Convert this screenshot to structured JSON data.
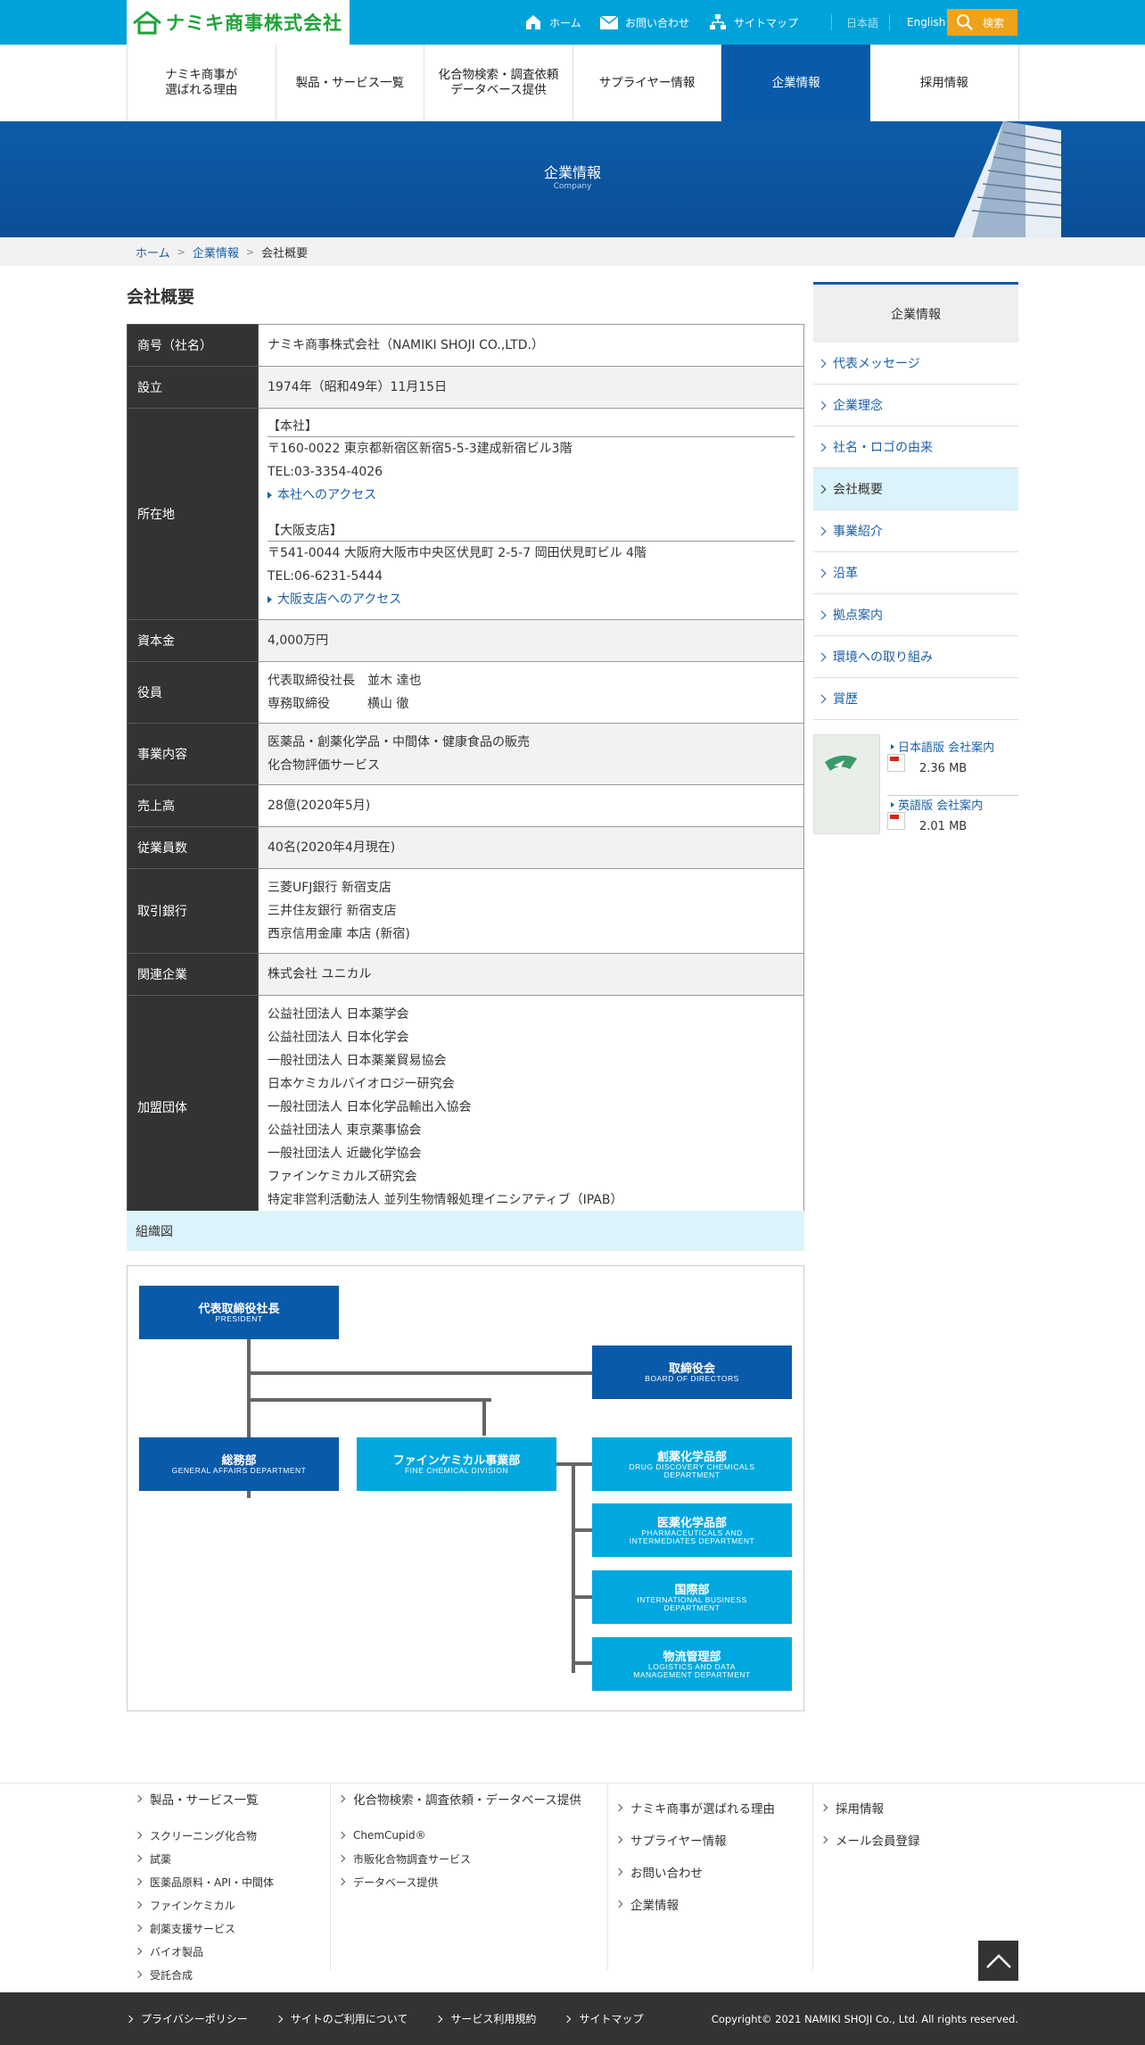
{
  "header": {
    "logo_text": "ナミキ商事株式会社",
    "links": {
      "home": "ホーム",
      "contact": "お問い合わせ",
      "sitemap": "サイトマップ",
      "lang_ja": "日本語",
      "lang_en": "English",
      "search": "検索"
    }
  },
  "gnav": [
    {
      "label": "ナミキ商事が\n選ばれる理由"
    },
    {
      "label": "製品・サービス一覧"
    },
    {
      "label": "化合物検索・調査依頼\nデータベース提供"
    },
    {
      "label": "サプライヤー情報"
    },
    {
      "label": "企業情報",
      "active": true
    },
    {
      "label": "採用情報"
    }
  ],
  "hero": {
    "title": "企業情報",
    "subtitle": "Company"
  },
  "breadcrumb": [
    "ホーム",
    "企業情報",
    "会社概要"
  ],
  "page_title": "会社概要",
  "table": {
    "trade_name": {
      "label": "商号（社名）",
      "value": "ナミキ商事株式会社（NAMIKI SHOJI CO.,LTD.）"
    },
    "founded": {
      "label": "設立",
      "value": "1974年（昭和49年）11月15日"
    },
    "location": {
      "label": "所在地",
      "hq": {
        "title": "【本社】",
        "address": "〒160-0022 東京都新宿区新宿5-5-3建成新宿ビル3階",
        "tel": "TEL:03-3354-4026",
        "access": "本社へのアクセス"
      },
      "osaka": {
        "title": "【大阪支店】",
        "address": "〒541-0044 大阪府大阪市中央区伏見町 2-5-7 岡田伏見町ビル 4階",
        "tel": "TEL:06-6231-5444",
        "access": "大阪支店へのアクセス"
      }
    },
    "capital": {
      "label": "資本金",
      "value": "4,000万円"
    },
    "officers": {
      "label": "役員",
      "lines": [
        "代表取締役社長　並木 達也",
        "専務取締役　　　横山 徹"
      ]
    },
    "business": {
      "label": "事業内容",
      "lines": [
        "医薬品・創薬化学品・中間体・健康食品の販売",
        "化合物評価サービス"
      ]
    },
    "sales": {
      "label": "売上高",
      "value": "28億(2020年5月)"
    },
    "employees": {
      "label": "従業員数",
      "value": "40名(2020年4月現在)"
    },
    "banks": {
      "label": "取引銀行",
      "lines": [
        "三菱UFJ銀行 新宿支店",
        "三井住友銀行 新宿支店",
        "西京信用金庫 本店 (新宿)"
      ]
    },
    "affiliates": {
      "label": "関連企業",
      "value": "株式会社 ユニカル"
    },
    "memberships": {
      "label": "加盟団体",
      "lines": [
        "公益社団法人 日本薬学会",
        "公益社団法人 日本化学会",
        "一般社団法人 日本薬業貿易協会",
        "日本ケミカルバイオロジー研究会",
        "一般社団法人 日本化学品輸出入協会",
        "公益社団法人 東京薬事協会",
        "一般社団法人 近畿化学協会",
        "ファインケミカルズ研究会",
        "特定非営利活動法人 並列生物情報処理イニシアティブ（IPAB）"
      ]
    }
  },
  "org": {
    "heading": "組織図",
    "president": {
      "ja": "代表取締役社長",
      "en": "PRESIDENT"
    },
    "board": {
      "ja": "取締役会",
      "en": "BOARD OF DIRECTORS"
    },
    "general": {
      "ja": "総務部",
      "en": "GENERAL AFFAIRS DEPARTMENT"
    },
    "fine": {
      "ja": "ファインケミカル事業部",
      "en": "FINE CHEMICAL DIVISION"
    },
    "drug": {
      "ja": "創薬化学品部",
      "en1": "DRUG DISCOVERY CHEMICALS",
      "en2": "DEPARTMENT"
    },
    "pharma": {
      "ja": "医薬化学品部",
      "en1": "PHARMACEUTICALS AND",
      "en2": "INTERMEDIATES DEPARTMENT"
    },
    "intl": {
      "ja": "国際部",
      "en1": "INTERNATIONAL BUSINESS",
      "en2": "DEPARTMENT"
    },
    "logistics": {
      "ja": "物流管理部",
      "en1": "LOGISTICS AND DATA",
      "en2": "MANAGEMENT DEPARTMENT"
    }
  },
  "sidebar": {
    "heading": "企業情報",
    "items": [
      "代表メッセージ",
      "企業理念",
      "社名・ロゴの由来",
      "会社概要",
      "事業紹介",
      "沿革",
      "拠点案内",
      "環境への取り組み",
      "賞歴"
    ],
    "current": "会社概要",
    "pdfs": [
      {
        "label": "日本語版 会社案内",
        "size": "2.36 MB"
      },
      {
        "label": "英語版 会社案内",
        "size": "2.01 MB"
      }
    ]
  },
  "footer": {
    "col1": {
      "head": "製品・サービス一覧",
      "items": [
        "スクリーニング化合物",
        "試薬",
        "医薬品原料・API・中間体",
        "ファインケミカル",
        "創薬支援サービス",
        "バイオ製品",
        "受託合成"
      ]
    },
    "col2": {
      "head": "化合物検索・調査依頼・データベース提供",
      "items": [
        "ChemCupid®",
        "市販化合物調査サービス",
        "データベース提供"
      ]
    },
    "col3": [
      "ナミキ商事が選ばれる理由",
      "サプライヤー情報",
      "お問い合わせ",
      "企業情報"
    ],
    "col4": [
      "採用情報",
      "メール会員登録"
    ],
    "bottom_links": [
      "プライバシーポリシー",
      "サイトのご利用について",
      "サービス利用規約",
      "サイトマップ"
    ],
    "copyright": "Copyright© 2021 NAMIKI SHOJI Co., Ltd. All rights reserved."
  }
}
